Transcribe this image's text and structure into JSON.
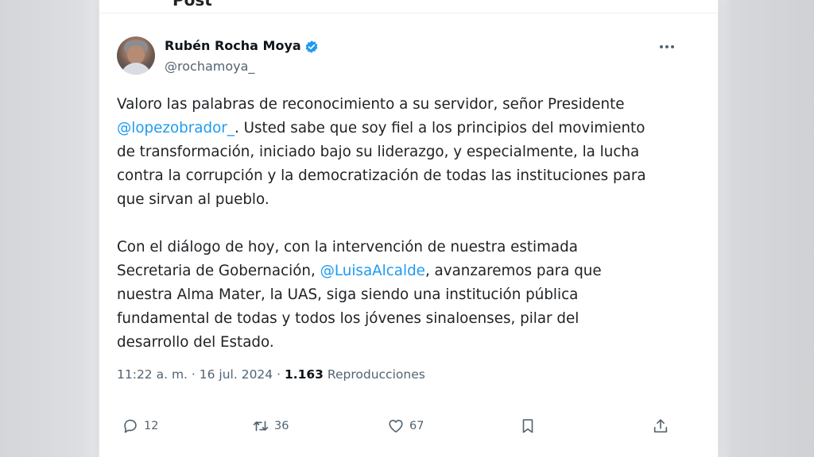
{
  "header": {
    "title": "Post"
  },
  "author": {
    "name": "Rubén Rocha Moya",
    "handle": "@rochamoya_"
  },
  "tweet": {
    "paragraph1": [
      "Valoro las palabras de reconocimiento a su servidor, señor Presidente",
      {
        "mention": "@lopezobrador_",
        "after": ". Usted sabe que soy fiel a los principios del movimiento"
      },
      "de transformación, iniciado bajo su liderazgo, y especialmente, la lucha",
      "contra la corrupción y la democratización de todas las instituciones para",
      "que sirvan al pueblo."
    ],
    "p1_line1": "Valoro las palabras de reconocimiento a su servidor, señor Presidente",
    "p1_line2_mention": "@lopezobrador_",
    "p1_line2_rest": ". Usted sabe que soy fiel a los principios del movimiento",
    "p1_line3": "de transformación, iniciado bajo su liderazgo, y especialmente, la lucha",
    "p1_line4": "contra la corrupción y la democratización de todas las instituciones para",
    "p1_line5": "que sirvan al pueblo.",
    "p2_line1": "Con el diálogo de hoy, con la intervención de nuestra estimada",
    "p2_line2_before": "Secretaria de Gobernación, ",
    "p2_line2_mention": "@LuisaAlcalde",
    "p2_line2_rest": ", avanzaremos para que",
    "p2_line3": "nuestra Alma Mater, la UAS, siga siendo una institución pública",
    "p2_line4": "fundamental de todas y todos los  jóvenes sinaloenses, pilar del",
    "p2_line5": "desarrollo del Estado."
  },
  "meta": {
    "time": "11:22 a. m.",
    "separator": " · ",
    "date": "16 jul. 2024",
    "views": "1.163",
    "views_label": "Reproducciones"
  },
  "actions": {
    "replies": "12",
    "reposts": "36",
    "likes": "67"
  },
  "colors": {
    "accent": "#1d9bf0",
    "text": "#0f1419",
    "secondary": "#536471"
  }
}
